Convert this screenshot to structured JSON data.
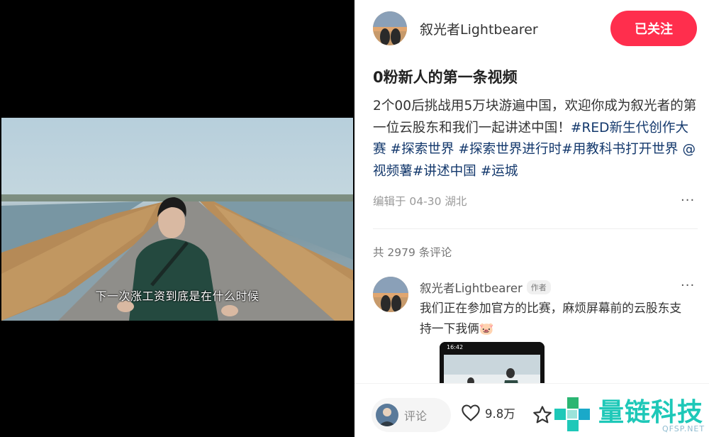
{
  "video": {
    "subtitle": "下一次涨工资到底是在什么时候"
  },
  "author": {
    "name": "叙光者Lightbearer",
    "follow_label": "已关注"
  },
  "note": {
    "title": "0粉新人的第一条视频",
    "desc_text": "2个00后挑战用5万块游遍中国，欢迎你成为叙光者的第一位云股东和我们一起讲述中国！",
    "tags": [
      "#RED新生代创作大赛",
      "#探索世界",
      "#探索世界进行时",
      "#用教科书打开世界",
      "@视频薯",
      "#讲述中国",
      "#运城"
    ],
    "meta": "编辑于 04-30 湖北",
    "more": "···"
  },
  "comments": {
    "count_label": "共 2979 条评论",
    "items": [
      {
        "author": "叙光者Lightbearer",
        "badge": "作者",
        "text": "我们正在参加官方的比赛，麻烦屏幕前的云股东支持一下我俩🐷",
        "more": "···",
        "image_time": "16:42"
      }
    ]
  },
  "bottom_bar": {
    "comment_placeholder": "评论",
    "like_count": "9.8万",
    "like_icon": "heart-icon",
    "star_icon": "star-icon"
  },
  "watermark": {
    "name": "量链科技",
    "url": "QFSP.NET"
  },
  "colors": {
    "accent": "#ff2e4d",
    "tag": "#13386c",
    "watermark": "#1ec8b8"
  }
}
